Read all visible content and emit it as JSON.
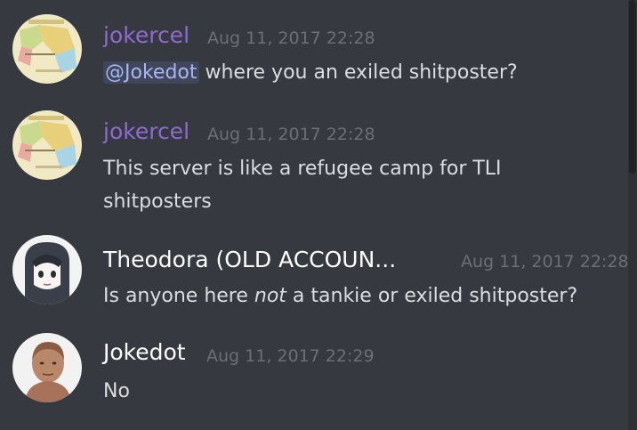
{
  "messages": [
    {
      "author": "jokercel",
      "author_color": "#8e6ad1",
      "timestamp": "Aug 11, 2017 22:28",
      "mention": "@Jokedot",
      "text": " where you an exiled shitposter?",
      "avatar": "map-avatar-icon"
    },
    {
      "author": "jokercel",
      "author_color": "#8e6ad1",
      "timestamp": "Aug 11, 2017 22:28",
      "line1": "This server is like a refugee camp for TLI",
      "line2": "shitposters",
      "avatar": "map-avatar-icon"
    },
    {
      "author": "Theodora (OLD ACCOUN...",
      "author_color": "#ffffff",
      "timestamp": "Aug 11, 2017 22:28",
      "text_before": "Is anyone here ",
      "text_em": "not",
      "text_after": " a tankie or exiled shitposter?",
      "avatar": "anime-girl-avatar-icon"
    },
    {
      "author": "Jokedot",
      "author_color": "#ffffff",
      "timestamp": "Aug 11, 2017 22:29",
      "text": "No",
      "avatar": "bust-avatar-icon"
    }
  ]
}
